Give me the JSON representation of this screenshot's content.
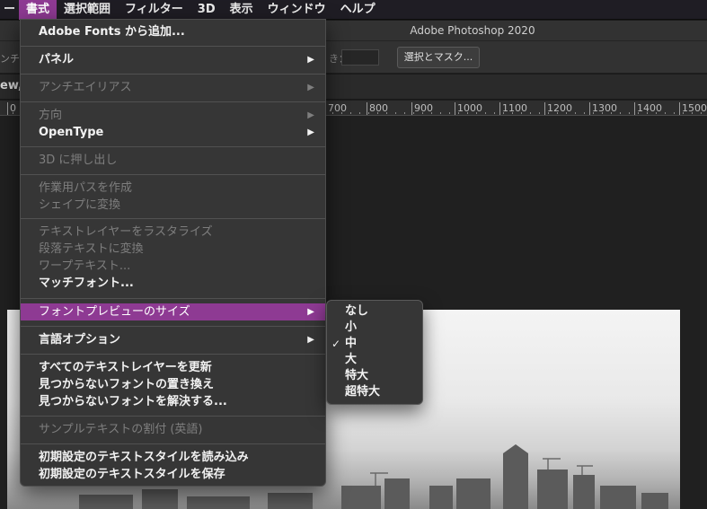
{
  "menubar": {
    "items": [
      {
        "label": "ー"
      },
      {
        "label": "書式"
      },
      {
        "label": "選択範囲"
      },
      {
        "label": "フィルター"
      },
      {
        "label": "3D"
      },
      {
        "label": "表示"
      },
      {
        "label": "ウィンドウ"
      },
      {
        "label": "ヘルプ"
      }
    ]
  },
  "app": {
    "title": "Adobe Photoshop 2020"
  },
  "options_bar": {
    "left_text": "ンチ",
    "field_label": "き：",
    "mask_button": "選択とマスク..."
  },
  "tab": {
    "label": "ew,"
  },
  "ruler": {
    "ticks": [
      "0",
      "700",
      "800",
      "900",
      "1000",
      "1100",
      "1200",
      "1300",
      "1400",
      "1500"
    ]
  },
  "menu": {
    "items": [
      {
        "label": "Adobe Fonts から追加..."
      },
      {
        "label": "パネル",
        "arrow": "▶"
      },
      {
        "label": "アンチエイリアス",
        "arrow": "▶"
      },
      {
        "label": "方向",
        "arrow": "▶"
      },
      {
        "label": "OpenType",
        "arrow": "▶"
      },
      {
        "label": "3D に押し出し"
      },
      {
        "label": "作業用パスを作成"
      },
      {
        "label": "シェイプに変換"
      },
      {
        "label": "テキストレイヤーをラスタライズ"
      },
      {
        "label": "段落テキストに変換"
      },
      {
        "label": "ワープテキスト..."
      },
      {
        "label": "マッチフォント..."
      },
      {
        "label": "フォントプレビューのサイズ",
        "arrow": "▶"
      },
      {
        "label": "言語オプション",
        "arrow": "▶"
      },
      {
        "label": "すべてのテキストレイヤーを更新"
      },
      {
        "label": "見つからないフォントの置き換え"
      },
      {
        "label": "見つからないフォントを解決する..."
      },
      {
        "label": "サンプルテキストの割付 (英語)"
      },
      {
        "label": "初期設定のテキストスタイルを読み込み"
      },
      {
        "label": "初期設定のテキストスタイルを保存"
      }
    ]
  },
  "submenu": {
    "check_mark": "✓",
    "selected": "中",
    "items": [
      {
        "label": "なし"
      },
      {
        "label": "小"
      },
      {
        "label": "中"
      },
      {
        "label": "大"
      },
      {
        "label": "特大"
      },
      {
        "label": "超特大"
      }
    ]
  },
  "colors": {
    "accent": "#8e3a93",
    "menu_bg": "#363636",
    "disabled_text": "#7e7e7e"
  }
}
